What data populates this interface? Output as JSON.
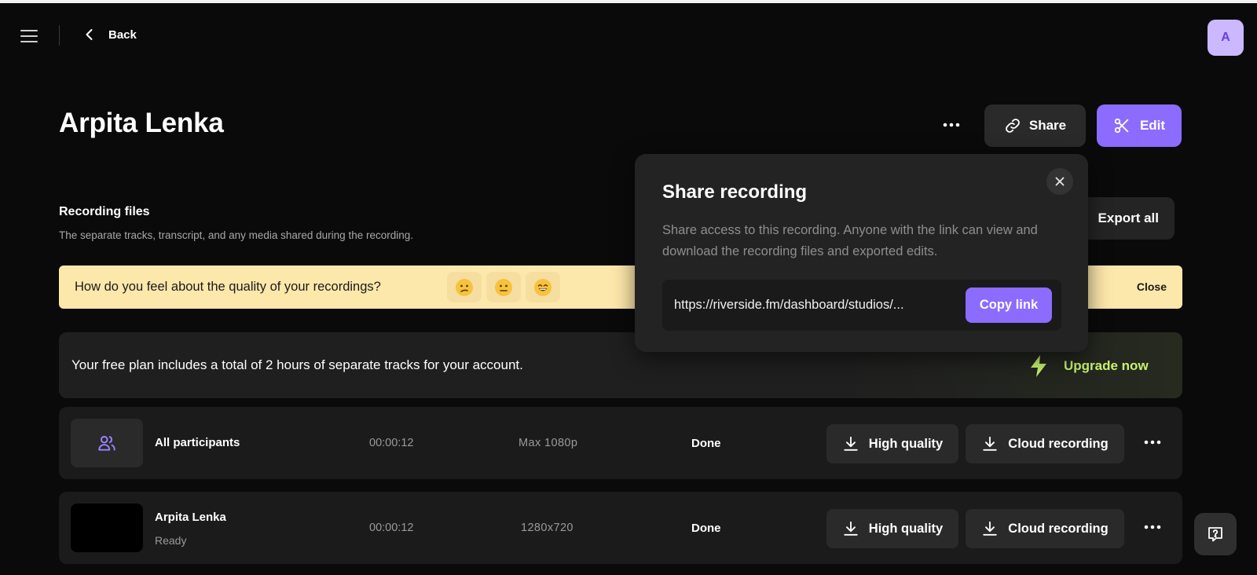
{
  "topbar": {
    "back_label": "Back",
    "avatar_initial": "A"
  },
  "header": {
    "title": "Arpita Lenka",
    "share_label": "Share",
    "edit_label": "Edit"
  },
  "section": {
    "title": "Recording files",
    "subtitle": "The separate tracks, transcript, and any media shared during the recording.",
    "export_label": "Export all"
  },
  "feedback": {
    "question": "How do you feel about the quality of your recordings?",
    "emojis": [
      "😕",
      "😐",
      "😄"
    ],
    "close_label": "Close"
  },
  "upgrade": {
    "text": "Your free plan includes a total of 2 hours of separate tracks for your account.",
    "cta": "Upgrade now"
  },
  "tracks": [
    {
      "name": "All participants",
      "sub": "",
      "duration": "00:00:12",
      "resolution": "Max 1080p",
      "status": "Done",
      "hq_label": "High quality",
      "cloud_label": "Cloud recording"
    },
    {
      "name": "Arpita Lenka",
      "sub": "Ready",
      "duration": "00:00:12",
      "resolution": "1280x720",
      "status": "Done",
      "hq_label": "High quality",
      "cloud_label": "Cloud recording"
    }
  ],
  "share_popover": {
    "title": "Share recording",
    "description": "Share access to this recording. Anyone with the link can view and download the recording files and exported edits.",
    "url": "https://riverside.fm/dashboard/studios/...",
    "copy_label": "Copy link"
  },
  "colors": {
    "accent": "#8b6cff",
    "upgrade_green": "#c7f36e",
    "feedback_bg": "#fde8ab",
    "background": "#0a0a0a"
  },
  "icons": [
    "menu-icon",
    "chevron-left-icon",
    "more-horizontal-icon",
    "link-icon",
    "scissors-icon",
    "close-icon",
    "lightning-icon",
    "users-icon",
    "download-icon",
    "help-icon"
  ]
}
